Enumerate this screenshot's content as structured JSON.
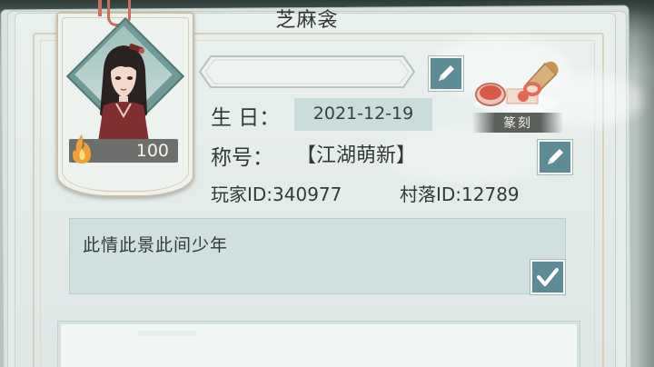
{
  "profile": {
    "name": "芝麻衾",
    "level": "100",
    "birthday_label": "生  日：",
    "birthday": "2021-12-19",
    "title_label": "称号：",
    "title": "【江湖萌新】",
    "player_id": "玩家ID:340977",
    "village_id": "村落ID:12789"
  },
  "seal": {
    "label": "篆刻"
  },
  "signature": {
    "text": "此情此景此间少年"
  },
  "colors": {
    "accent_button": "#5d8c96",
    "page_bg": "#e9f0ee",
    "input_bg": "#cbdcdc",
    "ribbon": "#c96f62"
  }
}
